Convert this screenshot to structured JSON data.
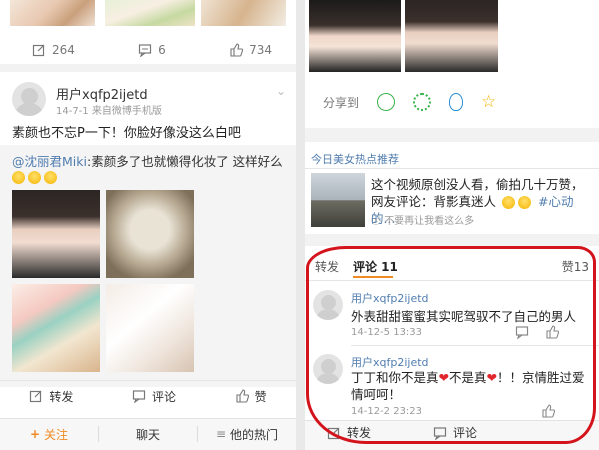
{
  "left": {
    "top_actions": {
      "repost_count": "264",
      "comment_count": "6",
      "like_count": "734"
    },
    "post": {
      "username": "用户xqfp2ijetd",
      "meta": "14-7-1  来自微博手机版",
      "text": "素颜也不忘P一下！你脸好像没这么白吧",
      "quoted_mention": "@沈丽君Miki",
      "quoted_text": ":素颜多了也就懒得化妆了 这样好么"
    },
    "actions": {
      "repost": "转发",
      "comment": "评论",
      "like": "赞"
    },
    "bottom_nav": {
      "follow": "关注",
      "chat": "聊天",
      "hot": "他的热门"
    }
  },
  "right": {
    "share_label": "分享到",
    "hot_section_title": "今日美女热点推荐",
    "recommend": {
      "text": "这个视频原创没人看，偷拍几十万赞，网友评论：背影真迷人",
      "tag": "#心动的...",
      "dismiss": "不要再让我看这么多"
    },
    "tabs": {
      "repost": "转发",
      "comment": "评论 11",
      "like": "赞13"
    },
    "comments": [
      {
        "username": "用户xqfp2ijetd",
        "text": "外表甜甜蜜蜜其实呢驾驭不了自己的男人",
        "time": "14-12-5 13:33"
      },
      {
        "username": "用户xqfp2ijetd",
        "text_a": "丁丁和你不是真",
        "text_b": "不是真",
        "text_c": "！！京情胜过爱情呵呵！",
        "time": "14-12-2 23:23"
      }
    ],
    "bottom_actions": {
      "repost": "转发",
      "comment": "评论"
    }
  },
  "colors": {
    "accent_orange": "#f08a24",
    "link_blue": "#507daf",
    "annotation_red": "#d4141c"
  }
}
